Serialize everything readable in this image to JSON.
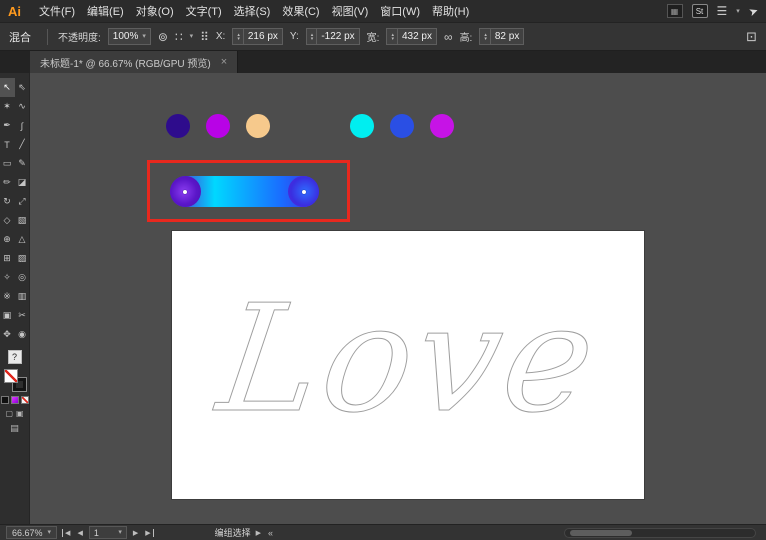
{
  "app": {
    "logo": "Ai"
  },
  "menubar": {
    "items": [
      "文件(F)",
      "编辑(E)",
      "对象(O)",
      "文字(T)",
      "选择(S)",
      "效果(C)",
      "视图(V)",
      "窗口(W)",
      "帮助(H)"
    ],
    "stock_badge": "St"
  },
  "controlbar": {
    "mode": "混合",
    "opacity_label": "不透明度:",
    "opacity_value": "100%",
    "x_label": "X:",
    "x_value": "216 px",
    "y_label": "Y:",
    "y_value": "-122 px",
    "w_label": "宽:",
    "w_value": "432 px",
    "h_label": "高:",
    "h_value": "82 px"
  },
  "tabbar": {
    "title": "未标题-1* @ 66.67% (RGB/GPU 预览)"
  },
  "toolbar": {
    "tools": [
      {
        "name": "selection",
        "glyph": "↖",
        "active": true
      },
      {
        "name": "direct-selection",
        "glyph": "⇖"
      },
      {
        "name": "magic-wand",
        "glyph": "✶"
      },
      {
        "name": "lasso",
        "glyph": "∿"
      },
      {
        "name": "pen",
        "glyph": "✒"
      },
      {
        "name": "curvature",
        "glyph": "∫"
      },
      {
        "name": "type",
        "glyph": "T"
      },
      {
        "name": "line-segment",
        "glyph": "╱"
      },
      {
        "name": "rectangle",
        "glyph": "▭"
      },
      {
        "name": "paintbrush",
        "glyph": "✎"
      },
      {
        "name": "shaper",
        "glyph": "✏"
      },
      {
        "name": "eraser",
        "glyph": "◪"
      },
      {
        "name": "rotate",
        "glyph": "↻"
      },
      {
        "name": "scale",
        "glyph": "⤢"
      },
      {
        "name": "width",
        "glyph": "◇"
      },
      {
        "name": "free-transform",
        "glyph": "▧"
      },
      {
        "name": "shape-builder",
        "glyph": "⊕"
      },
      {
        "name": "perspective-grid",
        "glyph": "△"
      },
      {
        "name": "mesh",
        "glyph": "⊞"
      },
      {
        "name": "gradient",
        "glyph": "▨"
      },
      {
        "name": "eyedropper",
        "glyph": "✧"
      },
      {
        "name": "blend",
        "glyph": "◎"
      },
      {
        "name": "symbol-sprayer",
        "glyph": "※"
      },
      {
        "name": "column-graph",
        "glyph": "▥"
      },
      {
        "name": "artboard",
        "glyph": "▣"
      },
      {
        "name": "slice",
        "glyph": "✂"
      },
      {
        "name": "hand",
        "glyph": "✥"
      },
      {
        "name": "zoom",
        "glyph": "◉"
      }
    ]
  },
  "canvas": {
    "circles": [
      "#2e0c8c",
      "#b803e6",
      "#f6c98c",
      "#00eef0",
      "#2a4fe4",
      "#c613e6"
    ],
    "blend": {
      "left": "#5a16c8",
      "cyan": "#00d8ff",
      "blue": "#1a6cff",
      "right": "#4328dc"
    },
    "highlight_color": "#e8281e",
    "artboard_text": "Love"
  },
  "statusbar": {
    "zoom": "66.67%",
    "page": "1",
    "tool_label": "编组选择"
  },
  "icons": {
    "caret_down": "▾",
    "stepper_up": "▴",
    "stepper_down": "▾",
    "prev": "◀",
    "next": "▶",
    "double_left": "«",
    "close": "×",
    "recolor": "⊚",
    "align": "∷",
    "grid": "⠿",
    "constrain": "∞",
    "transform": "⊡",
    "menu_grid": "▦",
    "workspace": "☰",
    "share": "➤",
    "help": "?"
  }
}
